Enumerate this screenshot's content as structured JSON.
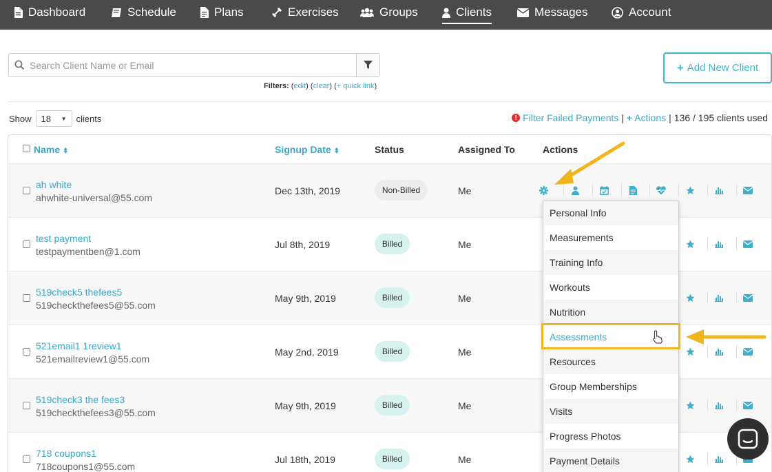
{
  "nav": {
    "items": [
      {
        "label": "Dashboard",
        "icon": "file-icon"
      },
      {
        "label": "Schedule",
        "icon": "book-icon"
      },
      {
        "label": "Plans",
        "icon": "document-icon"
      },
      {
        "label": "Exercises",
        "icon": "dumbbell-icon"
      },
      {
        "label": "Groups",
        "icon": "users-icon"
      },
      {
        "label": "Clients",
        "icon": "user-icon",
        "active": true
      },
      {
        "label": "Messages",
        "icon": "envelope-icon"
      },
      {
        "label": "Account",
        "icon": "user-circle-icon"
      }
    ]
  },
  "search": {
    "placeholder": "Search Client Name or Email"
  },
  "filters": {
    "label": "Filters:",
    "edit": "edit",
    "clear": "clear",
    "quick_link": "+ quick link"
  },
  "add_client": {
    "label": "Add New Client"
  },
  "show": {
    "prefix": "Show",
    "value": "18",
    "suffix": "clients"
  },
  "toolbar": {
    "failed_payments": "Filter Failed Payments",
    "actions": "Actions",
    "usage": "136 / 195 clients used"
  },
  "table": {
    "headers": {
      "name": "Name",
      "signup": "Signup Date",
      "status": "Status",
      "assigned": "Assigned To",
      "actions": "Actions"
    },
    "rows": [
      {
        "name": "ah white",
        "email": "ahwhite-universal@55.com",
        "date": "Dec 13th, 2019",
        "status": "Non-Billed",
        "assigned": "Me"
      },
      {
        "name": "test payment",
        "email": "testpaymentben@1.com",
        "date": "Jul 8th, 2019",
        "status": "Billed",
        "assigned": "Me"
      },
      {
        "name": "519check5 thefees5",
        "email": "519checkthefees5@55.com",
        "date": "May 9th, 2019",
        "status": "Billed",
        "assigned": "Me"
      },
      {
        "name": "521email1 1review1",
        "email": "521emailreview1@55.com",
        "date": "May 2nd, 2019",
        "status": "Billed",
        "assigned": "Me"
      },
      {
        "name": "519check3 the fees3",
        "email": "519checkthefees3@55.com",
        "date": "May 9th, 2019",
        "status": "Billed",
        "assigned": "Me"
      },
      {
        "name": "718 coupons1",
        "email": "718coupons1@55.com",
        "date": "Jul 18th, 2019",
        "status": "Billed",
        "assigned": "Me"
      }
    ]
  },
  "dropdown": {
    "items": [
      "Personal Info",
      "Measurements",
      "Training Info",
      "Workouts",
      "Nutrition",
      "Assessments",
      "Resources",
      "Group Memberships",
      "Visits",
      "Progress Photos",
      "Payment Details"
    ],
    "highlighted": "Assessments"
  },
  "colors": {
    "accent": "#39a9c9",
    "nav_bg": "#4a4a4a",
    "annotation": "#f0b51c",
    "billed_bg": "#d5f2ee"
  }
}
